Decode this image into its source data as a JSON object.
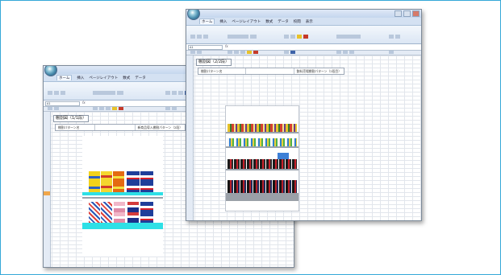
{
  "ribbon_tabs": [
    "ホーム",
    "挿入",
    "ページレイアウト",
    "数式",
    "データ",
    "校閲",
    "表示"
  ],
  "windows": {
    "back": {
      "sheet_title": "棚割図（1/1段）",
      "header_cells": [
        "棚割パターン名",
        "",
        "新商品導入棚割パターン（2段）"
      ],
      "name_box": "A1"
    },
    "front": {
      "sheet_title": "棚割図（2/2段）",
      "header_cells": [
        "棚割パターン名",
        "",
        "飲料売場棚割パターン（2段目）"
      ],
      "name_box": "A1"
    }
  },
  "colors": {
    "frame_border": "#35a8d8",
    "shelf_band": "#2ee0e6",
    "ribbon_bg": "#dbe6f4"
  },
  "icons": [
    "office-orb-icon",
    "minimize-icon",
    "maximize-icon",
    "close-icon"
  ]
}
